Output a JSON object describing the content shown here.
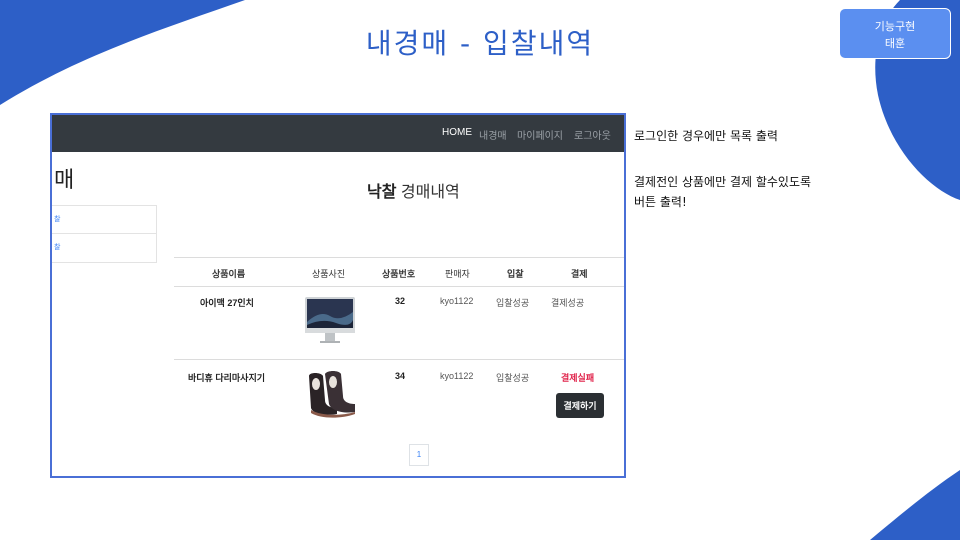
{
  "slide": {
    "title": "내경매 - 입찰내역",
    "badge_line1": "기능구현",
    "badge_line2": "태훈",
    "accent_color": "#2d5fc7",
    "notes": [
      "로그인한 경우에만 목록 출력",
      "결제전인 상품에만 결제 할수있도록",
      "버튼 출력!"
    ]
  },
  "navbar": {
    "items": [
      "HOME",
      "내경매",
      "마이페이지",
      "로그아웃"
    ],
    "active": "HOME"
  },
  "sidebar": {
    "title": "매",
    "links": [
      "찰",
      "찰"
    ]
  },
  "page": {
    "heading_bold": "낙찰",
    "heading_rest": " 경매내역"
  },
  "table": {
    "headers": [
      "상품이름",
      "상품사진",
      "상품번호",
      "판매자",
      "입찰",
      "결제"
    ],
    "rows": [
      {
        "name": "아이맥 27인치",
        "photo_icon": "imac-image",
        "number": "32",
        "seller": "kyo1122",
        "bid": "입찰성공",
        "payment": "결제성공",
        "payment_status": "success"
      },
      {
        "name": "바디휴 다리마사지기",
        "photo_icon": "leg-massager-image",
        "number": "34",
        "seller": "kyo1122",
        "bid": "입찰성공",
        "payment": "결제실패",
        "payment_status": "fail",
        "pay_button": "결제하기"
      }
    ]
  },
  "pagination": {
    "current": "1"
  }
}
